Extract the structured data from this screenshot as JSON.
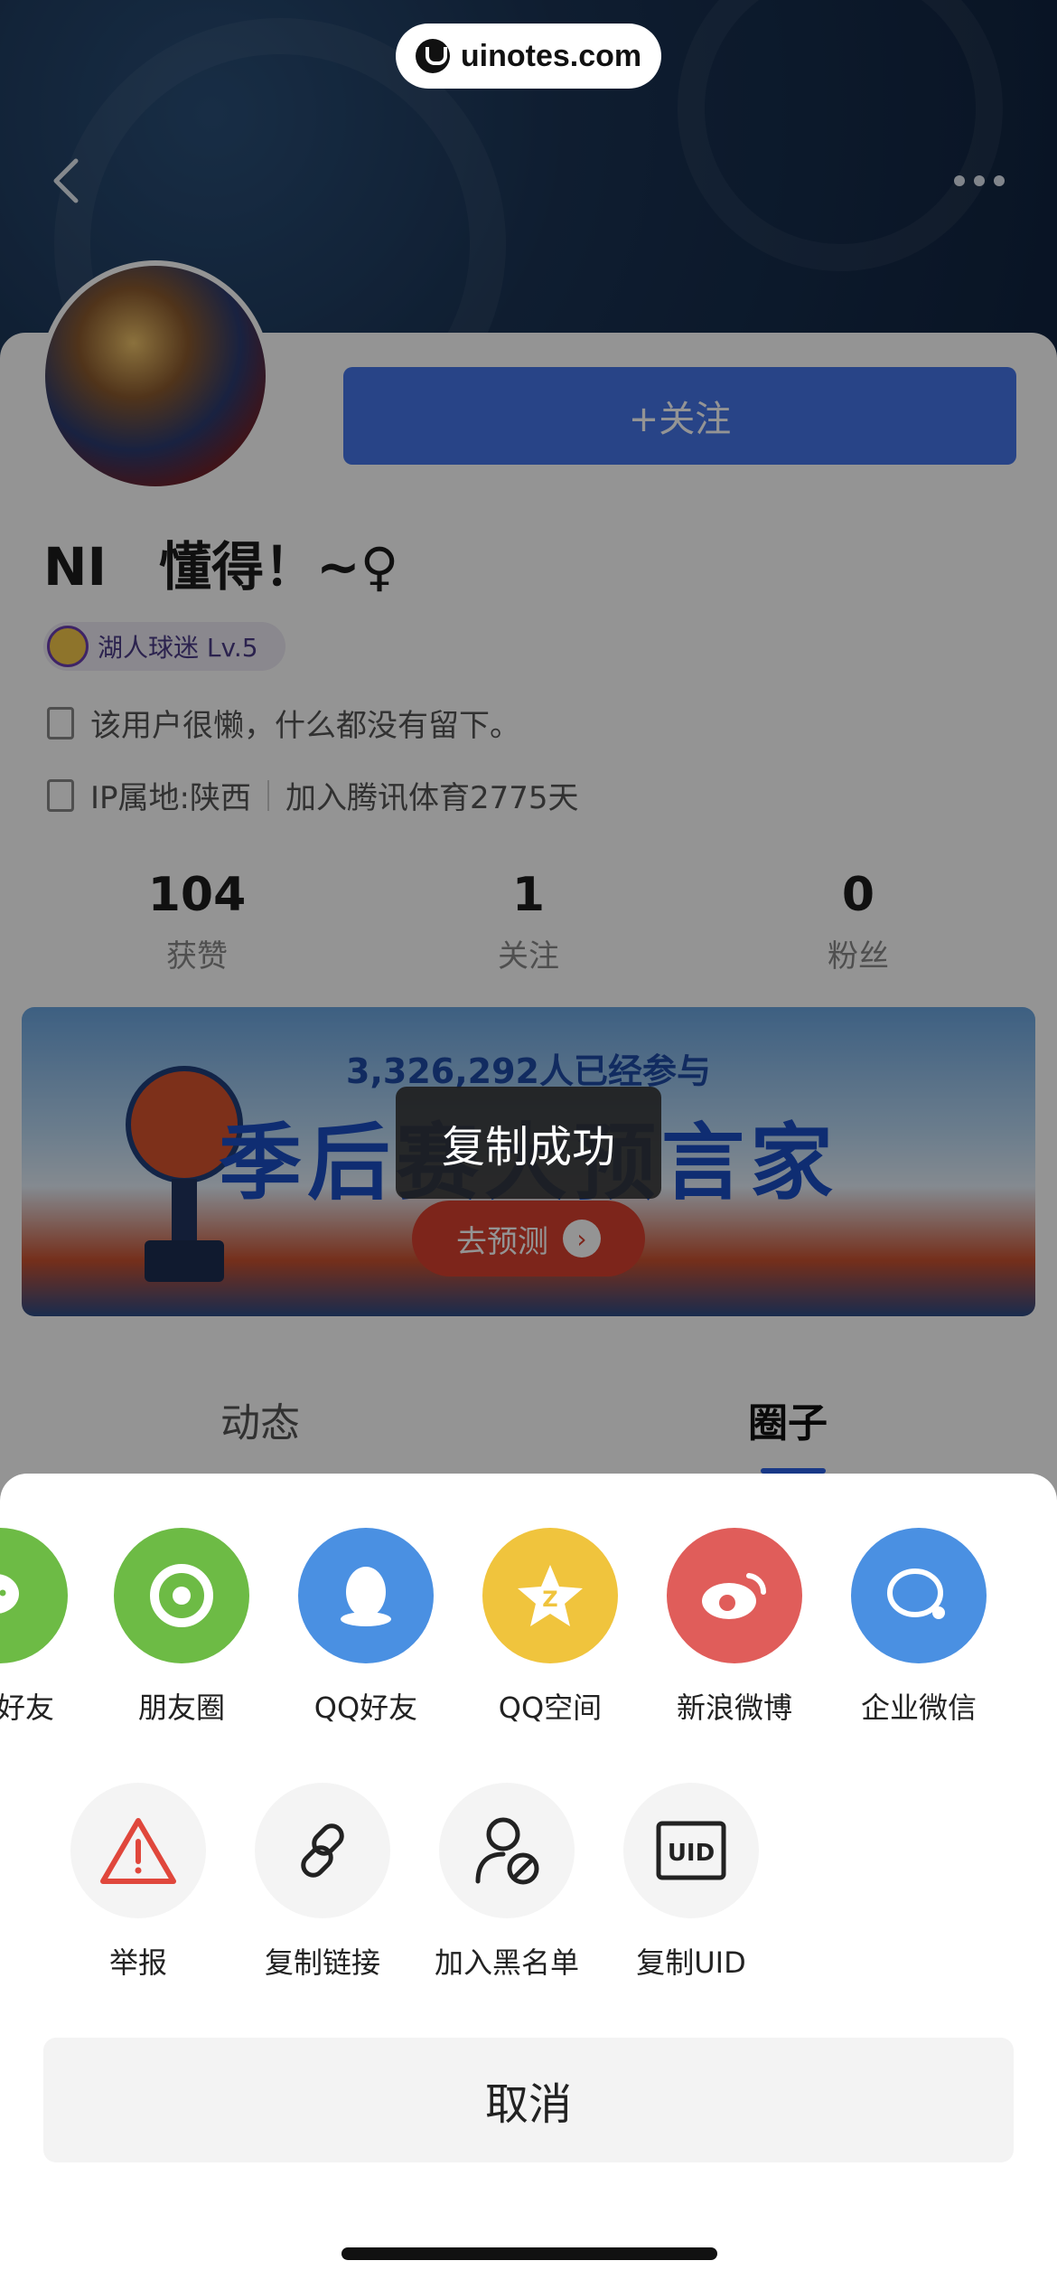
{
  "watermark": {
    "text": "uinotes.com"
  },
  "profile": {
    "follow_label": "+关注",
    "username": "NI　懂得！~♀",
    "level_badge": "湖人球迷 Lv.5",
    "bio": "该用户很懒，什么都没有留下。",
    "ip_location": "IP属地:陕西",
    "joined": "加入腾讯体育2775天"
  },
  "stats": [
    {
      "value": "104",
      "label": "获赞"
    },
    {
      "value": "1",
      "label": "关注"
    },
    {
      "value": "0",
      "label": "粉丝"
    }
  ],
  "banner": {
    "participants": "3,326,292人已经参与",
    "title": "季后赛大预言家",
    "cta": "去预测"
  },
  "tabs": [
    {
      "label": "动态",
      "active": false
    },
    {
      "label": "圈子",
      "active": true
    }
  ],
  "toast": {
    "text": "复制成功"
  },
  "share_targets": [
    {
      "label": "好友",
      "icon": "wechat-icon",
      "color": "#6dbb45"
    },
    {
      "label": "朋友圈",
      "icon": "moments-icon",
      "color": "#6dbb45"
    },
    {
      "label": "QQ好友",
      "icon": "qq-icon",
      "color": "#4a90e2"
    },
    {
      "label": "QQ空间",
      "icon": "qzone-icon",
      "color": "#f0c43d"
    },
    {
      "label": "新浪微博",
      "icon": "weibo-icon",
      "color": "#e05d5a"
    },
    {
      "label": "企业微信",
      "icon": "wecom-icon",
      "color": "#4a90e2"
    }
  ],
  "actions": [
    {
      "label": "举报",
      "icon": "warning-icon"
    },
    {
      "label": "复制链接",
      "icon": "link-icon"
    },
    {
      "label": "加入黑名单",
      "icon": "block-user-icon"
    },
    {
      "label": "复制UID",
      "icon": "uid-icon"
    }
  ],
  "cancel_label": "取消"
}
